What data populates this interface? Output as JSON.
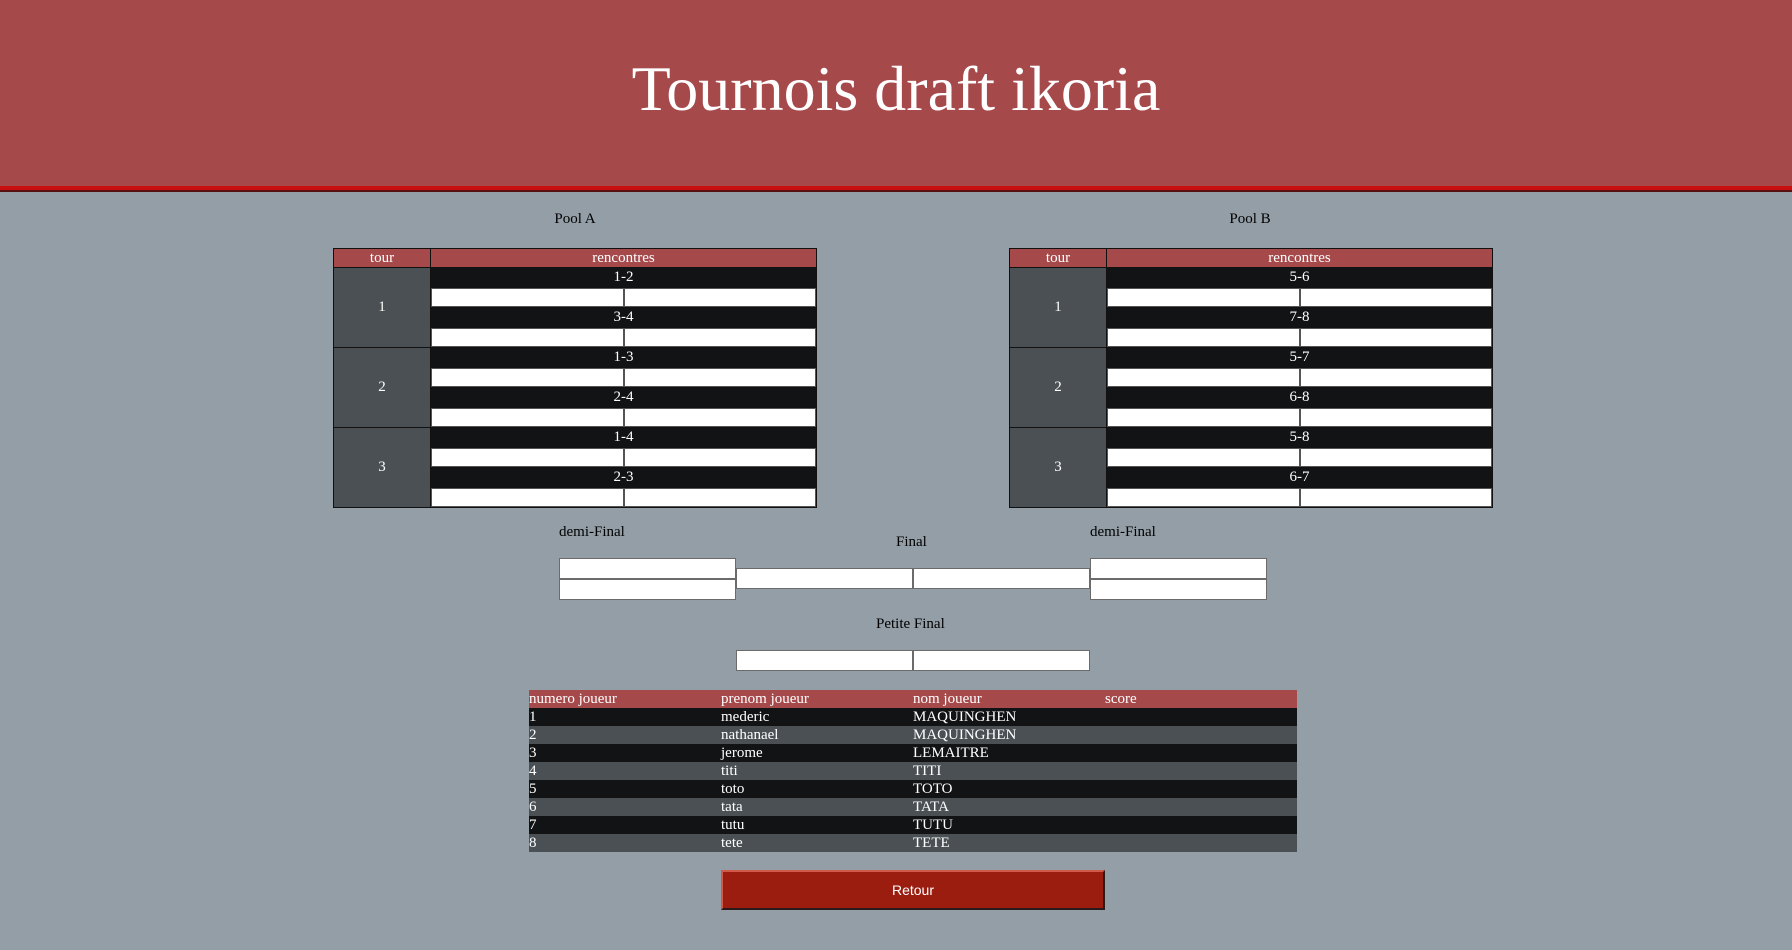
{
  "header": {
    "title": "Tournois draft ikoria"
  },
  "pools": [
    {
      "title": "Pool A",
      "col_tour": "tour",
      "col_rencontres": "rencontres",
      "rounds": [
        {
          "tour": "1",
          "matches": [
            "1-2",
            "3-4"
          ]
        },
        {
          "tour": "2",
          "matches": [
            "1-3",
            "2-4"
          ]
        },
        {
          "tour": "3",
          "matches": [
            "1-4",
            "2-3"
          ]
        }
      ]
    },
    {
      "title": "Pool B",
      "col_tour": "tour",
      "col_rencontres": "rencontres",
      "rounds": [
        {
          "tour": "1",
          "matches": [
            "5-6",
            "7-8"
          ]
        },
        {
          "tour": "2",
          "matches": [
            "5-7",
            "6-8"
          ]
        },
        {
          "tour": "3",
          "matches": [
            "5-8",
            "6-7"
          ]
        }
      ]
    }
  ],
  "bracket": {
    "demi_left_label": "demi-Final",
    "final_label": "Final",
    "demi_right_label": "demi-Final",
    "petite_final_label": "Petite Final"
  },
  "players_table": {
    "headers": [
      "numero joueur",
      "prenom joueur",
      "nom joueur",
      "score"
    ],
    "rows": [
      [
        "1",
        "mederic",
        "MAQUINGHEN",
        ""
      ],
      [
        "2",
        "nathanael",
        "MAQUINGHEN",
        ""
      ],
      [
        "3",
        "jerome",
        "LEMAITRE",
        ""
      ],
      [
        "4",
        "titi",
        "TITI",
        ""
      ],
      [
        "5",
        "toto",
        "TOTO",
        ""
      ],
      [
        "6",
        "tata",
        "TATA",
        ""
      ],
      [
        "7",
        "tutu",
        "TUTU",
        ""
      ],
      [
        "8",
        "tete",
        "TETE",
        ""
      ]
    ]
  },
  "retour_button": {
    "label": "Retour"
  },
  "colors": {
    "header_bg": "#a6494b",
    "header_border": "#c81010",
    "page_bg": "#939ea6",
    "dark_row": "#121314",
    "grey_row": "#4a5054",
    "button_bg": "#9a1d10"
  }
}
